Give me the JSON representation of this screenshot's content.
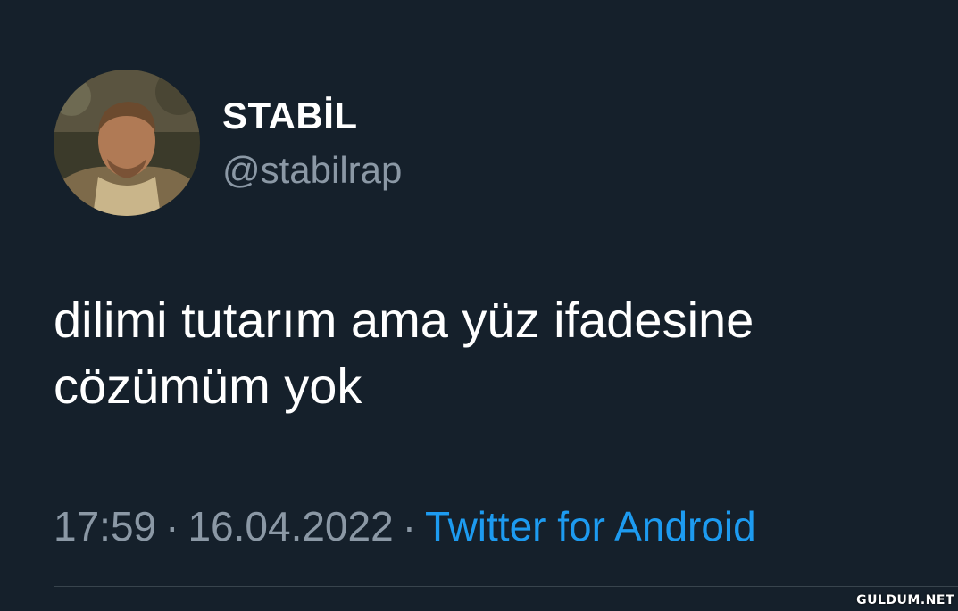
{
  "author": {
    "display_name": "STABİL",
    "handle": "@stabilrap"
  },
  "tweet": {
    "lines": [
      "dilimi tutarım ama yüz ifadesine",
      "cözümüm yok"
    ]
  },
  "meta": {
    "time": "17:59",
    "separator": "·",
    "date": "16.04.2022",
    "source": "Twitter for Android"
  },
  "watermark": "GULDUM.NET",
  "colors": {
    "background": "#15202b",
    "primary_text": "#ffffff",
    "secondary_text": "#8b98a5",
    "link": "#1d9bf0"
  }
}
